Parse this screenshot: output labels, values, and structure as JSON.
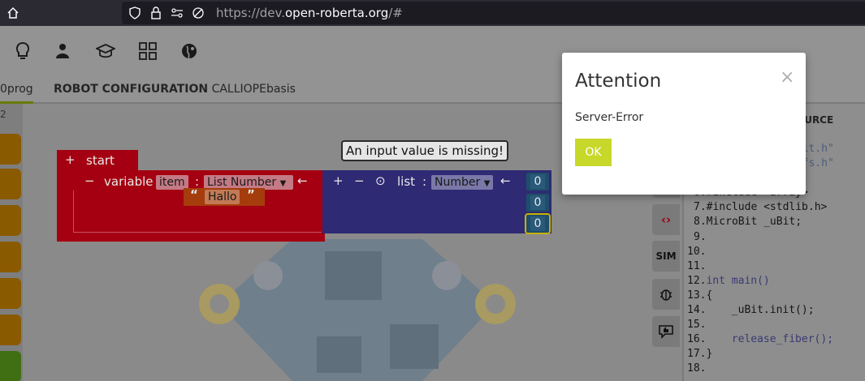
{
  "browser": {
    "url_prefix": "https://dev.",
    "url_domain": "open-roberta.org",
    "url_suffix": "/#"
  },
  "nav": {
    "icons": [
      "lightbulb-icon",
      "user-icon",
      "graduation-cap-icon",
      "grid-icon",
      "globe-icon"
    ]
  },
  "tabs": {
    "program_fragment": "0prog",
    "config_label": "ROBOT CONFIGURATION",
    "config_name": "CALLIOPEbasis"
  },
  "left_strip": {
    "number": "2"
  },
  "blocks": {
    "start_label": "start",
    "variable_label": "variable",
    "variable_name": "item",
    "variable_type": "List Number",
    "text_value": "Hallo",
    "list_label": "list",
    "list_type": "Number",
    "list_values": [
      "0",
      "0",
      "0"
    ],
    "tooltip": "An input value is missing!"
  },
  "tools": {
    "sim_label": "SIM"
  },
  "code": {
    "header": "OURCE",
    "lines": [
      {
        "num": "",
        "text": "oBit.h\""
      },
      {
        "num": "",
        "text": "Defs.h\""
      },
      {
        "num": "",
        "text": ">"
      },
      {
        "num": "6.",
        "text": "#include <array>"
      },
      {
        "num": "7.",
        "text": "#include <stdlib.h>"
      },
      {
        "num": "8.",
        "text": "MicroBit _uBit;"
      },
      {
        "num": "9.",
        "text": ""
      },
      {
        "num": "10.",
        "text": ""
      },
      {
        "num": "11.",
        "text": ""
      },
      {
        "num": "12.",
        "text": "int main()"
      },
      {
        "num": "13.",
        "text": "{"
      },
      {
        "num": "14.",
        "text": "    _uBit.init();"
      },
      {
        "num": "15.",
        "text": ""
      },
      {
        "num": "16.",
        "text": "    release_fiber();"
      },
      {
        "num": "17.",
        "text": "}"
      },
      {
        "num": "18.",
        "text": ""
      }
    ]
  },
  "dialog": {
    "title": "Attention",
    "close": "×",
    "message": "Server-Error",
    "ok_label": "OK"
  },
  "colors": {
    "ok_button": "#c8d82a",
    "variable_block": "#a50011",
    "list_block": "#2e2a73"
  }
}
